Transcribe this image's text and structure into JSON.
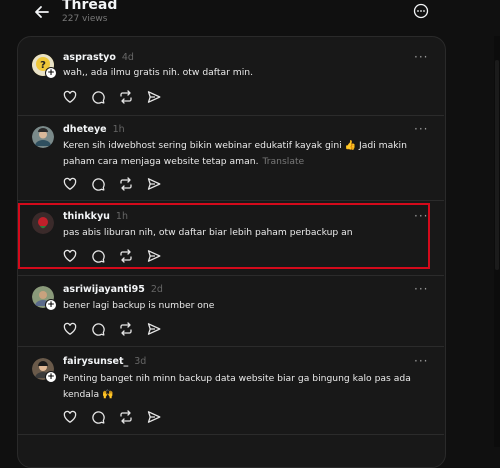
{
  "header": {
    "title": "Thread",
    "views": "227 views"
  },
  "ui": {
    "more": "···",
    "plus": "+"
  },
  "posts": [
    {
      "username": "asprastyo",
      "time": "4d",
      "text": "wah,, ada ilmu gratis nih. otw daftar min.",
      "translate": ""
    },
    {
      "username": "dheteye",
      "time": "1h",
      "text": "Keren sih idwebhost sering bikin webinar edukatif kayak gini 👍 Jadi makin paham cara menjaga website tetap aman.",
      "translate": "Translate"
    },
    {
      "username": "thinkkyu",
      "time": "1h",
      "text": "pas abis liburan nih, otw daftar biar lebih paham perbackup an",
      "translate": ""
    },
    {
      "username": "asriwijayanti95",
      "time": "2d",
      "text": "bener lagi backup is number one",
      "translate": ""
    },
    {
      "username": "fairysunset_",
      "time": "3d",
      "text": "Penting banget nih minn backup data website biar ga bingung kalo pas ada kendala 🙌",
      "translate": ""
    }
  ],
  "colors": {
    "background": "#101010",
    "panel": "#181818",
    "highlight": "#d40a1b"
  }
}
